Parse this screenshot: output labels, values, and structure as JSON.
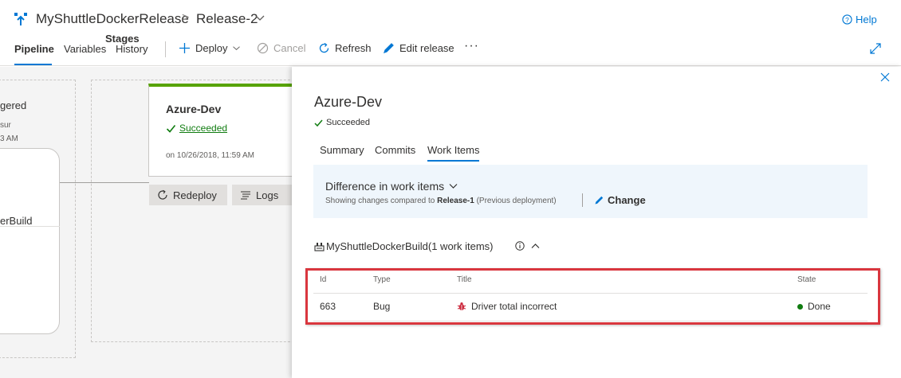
{
  "header": {
    "release_pipeline": "MyShuttleDockerRelease",
    "separator": ">",
    "release_name": "Release-2",
    "help_label": "Help"
  },
  "toolbar": {
    "tabs": [
      {
        "label": "Pipeline"
      },
      {
        "label": "Variables"
      },
      {
        "label": "History"
      }
    ],
    "deploy_label": "Deploy",
    "cancel_label": "Cancel",
    "refresh_label": "Refresh",
    "edit_label": "Edit release",
    "more_label": "···"
  },
  "canvas": {
    "stages_label": "Stages",
    "artifact_card": {
      "line1": "gered",
      "line2": "sur",
      "line3": "3 AM",
      "line4": "erBuild"
    },
    "stage": {
      "name": "Azure-Dev",
      "status": "Succeeded",
      "date": "on 10/26/2018, 11:59 AM"
    },
    "redeploy_label": "Redeploy",
    "logs_label": "Logs"
  },
  "panel": {
    "title": "Azure-Dev",
    "status": "Succeeded",
    "tabs": [
      {
        "label": "Summary"
      },
      {
        "label": "Commits"
      },
      {
        "label": "Work Items"
      }
    ],
    "difference": {
      "title": "Difference in work items",
      "sub_prefix": "Showing changes compared to",
      "sub_release": "Release-1",
      "sub_suffix": "(Previous deployment)",
      "change_label": "Change"
    },
    "build_heading": "MyShuttleDockerBuild(1 work items)",
    "table": {
      "headers": {
        "id": "Id",
        "type": "Type",
        "title": "Title",
        "state": "State"
      },
      "rows": [
        {
          "id": "663",
          "type": "Bug",
          "title": "Driver total incorrect",
          "state": "Done"
        }
      ]
    }
  },
  "colors": {
    "accent": "#0078d4",
    "success": "#107c10",
    "stage_bar": "#57a300",
    "highlight": "#d9363e",
    "bug": "#cc293d"
  }
}
